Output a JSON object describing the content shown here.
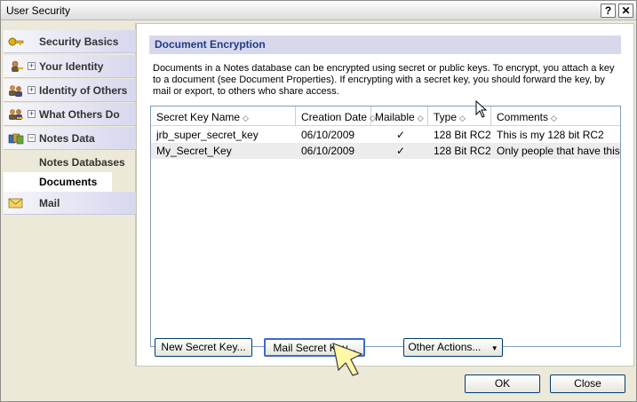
{
  "window": {
    "title": "User Security",
    "help_label": "?",
    "close_label": "✕"
  },
  "sidebar": {
    "items": [
      {
        "label": "Security Basics",
        "icon": "key-icon"
      },
      {
        "label": "Your Identity",
        "icon": "person-icon",
        "expander": "+"
      },
      {
        "label": "Identity of Others",
        "icon": "people-icon",
        "expander": "+"
      },
      {
        "label": "What Others Do",
        "icon": "people-key-icon",
        "expander": "+"
      },
      {
        "label": "Notes Data",
        "icon": "books-icon",
        "expander": "−"
      },
      {
        "label": "Notes Databases"
      },
      {
        "label": "Documents"
      },
      {
        "label": "Mail",
        "icon": "envelope-icon"
      }
    ]
  },
  "main": {
    "section_title": "Document Encryption",
    "description": "Documents in a Notes database can be encrypted using secret or public keys.  To encrypt, you attach a key to a document (see Document Properties).  If encrypting with a secret key, you should forward the key, by mail or export, to others who share access.",
    "table": {
      "columns": [
        "Secret Key Name",
        "Creation Date",
        "Mailable",
        "Type",
        "Comments"
      ],
      "rows": [
        {
          "name": "jrb_super_secret_key",
          "date": "06/10/2009",
          "mailable": "✓",
          "type": "128 Bit RC2",
          "comment": "This is my 128 bit RC2"
        },
        {
          "name": "My_Secret_Key",
          "date": "06/10/2009",
          "mailable": "✓",
          "type": "128 Bit RC2",
          "comment": "Only people that have this key"
        }
      ]
    },
    "buttons": {
      "new_key": "New Secret Key...",
      "mail_key": "Mail Secret Key...",
      "other_actions": "Other Actions...",
      "other_actions_arrow": "▼"
    }
  },
  "footer": {
    "ok": "OK",
    "close": "Close"
  },
  "colors": {
    "section_header_bg": "#d8d8ec",
    "section_header_text": "#1f3c88",
    "nav_gradient_end": "#d7d7ee"
  }
}
